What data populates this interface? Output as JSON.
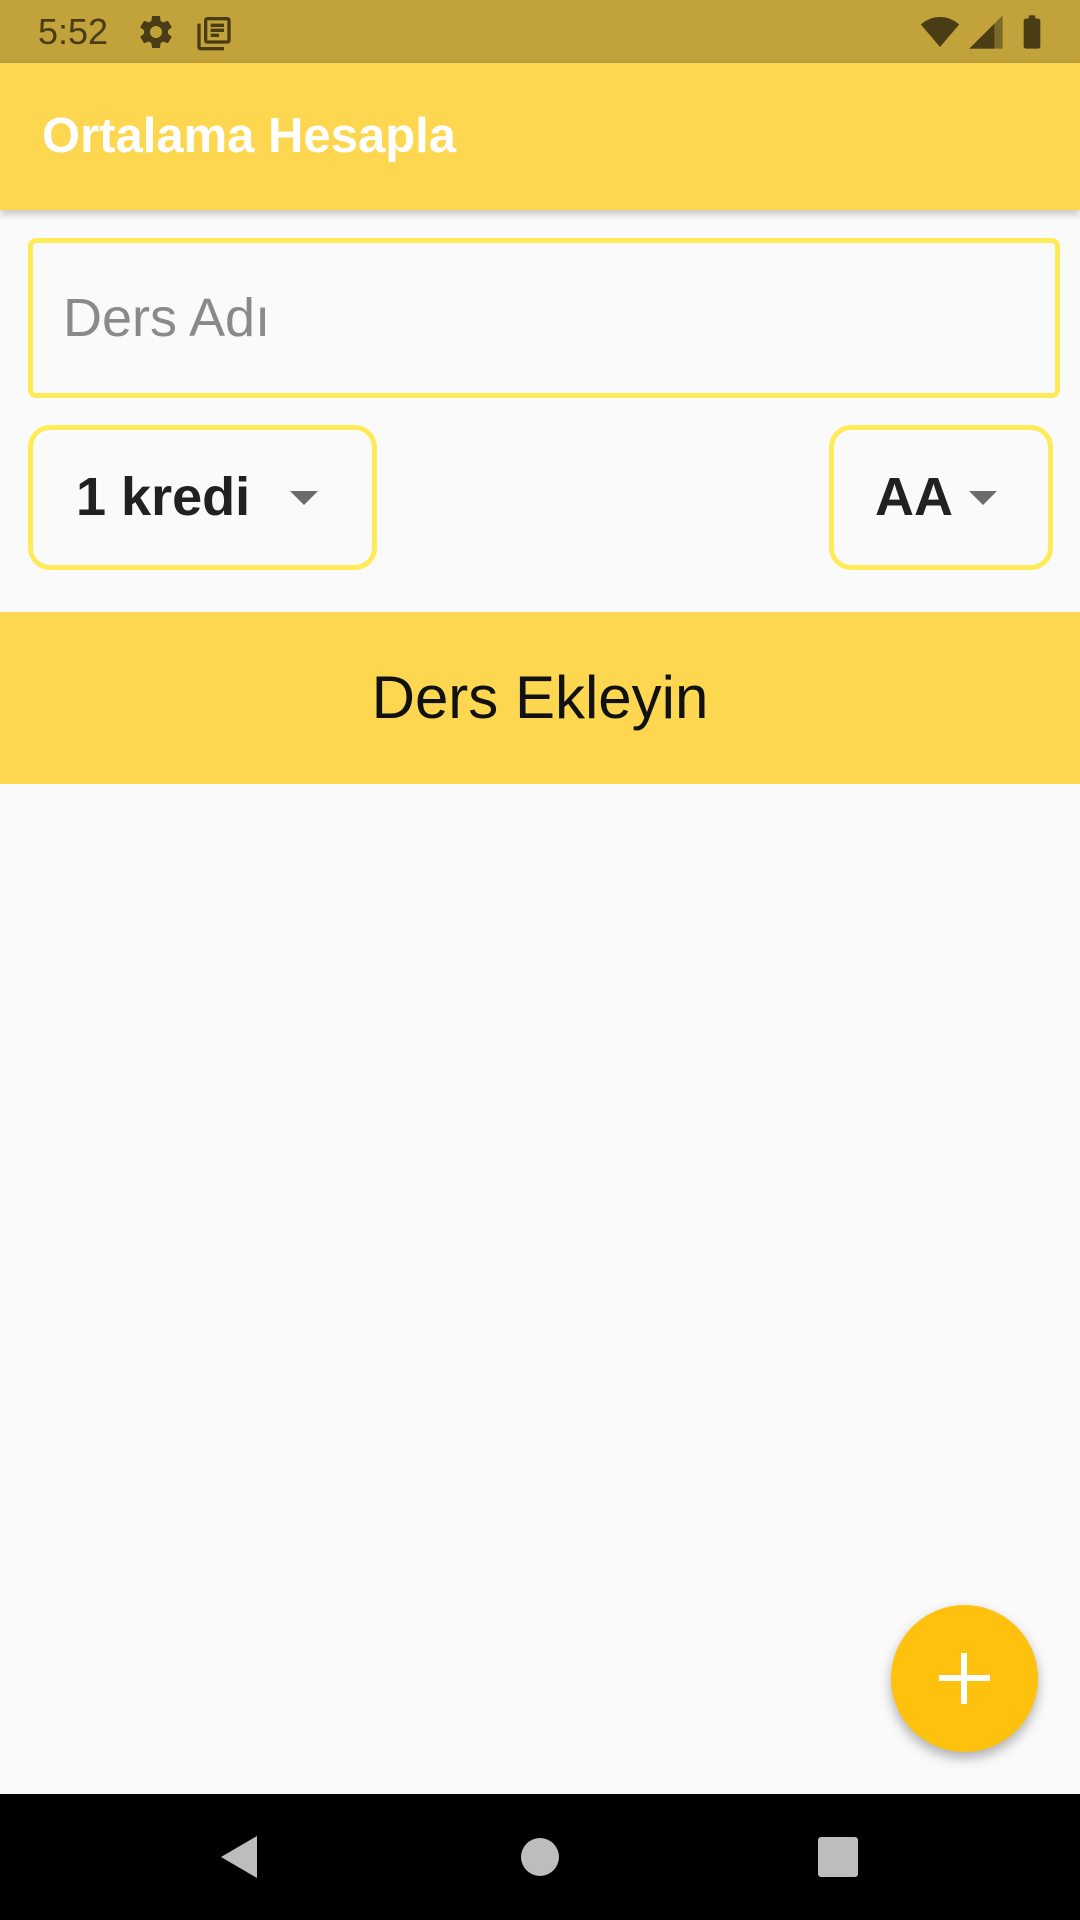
{
  "status_bar": {
    "time": "5:52",
    "icons": [
      "settings-icon",
      "news-icon",
      "wifi-icon",
      "cell-signal-icon",
      "battery-icon"
    ]
  },
  "app_bar": {
    "title": "Ortalama Hesapla"
  },
  "course_form": {
    "name_placeholder": "Ders Adı",
    "name_value": "",
    "credit_selected": "1 kredi",
    "grade_selected": "AA"
  },
  "add_banner": {
    "label": "Ders Ekleyin"
  },
  "fab": {
    "icon": "add-icon"
  },
  "nav_bar": {
    "icons": [
      "back-icon",
      "home-icon",
      "recents-icon"
    ]
  },
  "colors": {
    "status_bar": "#c1a23b",
    "app_bar": "#fed751",
    "accent_border": "#ffeb57",
    "fab": "#fdc10e",
    "background": "#fafafa"
  }
}
